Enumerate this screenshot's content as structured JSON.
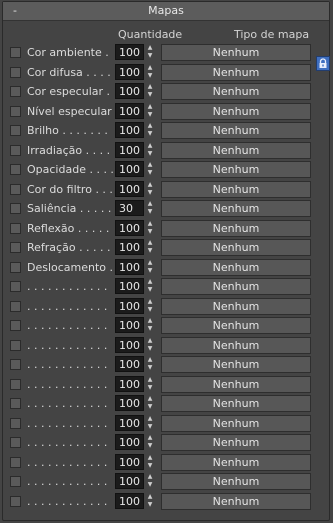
{
  "rollout": {
    "title": "Mapas",
    "collapse_symbol": "-"
  },
  "headers": {
    "amount": "Quantidade",
    "map_type": "Tipo de mapa"
  },
  "lock_icon": "lock-icon",
  "rows": [
    {
      "label": "Cor ambiente . .",
      "amount": "100",
      "map": "Nenhum"
    },
    {
      "label": "Cor difusa . . . .",
      "amount": "100",
      "map": "Nenhum"
    },
    {
      "label": "Cor especular . .",
      "amount": "100",
      "map": "Nenhum"
    },
    {
      "label": "Nível especular .",
      "amount": "100",
      "map": "Nenhum"
    },
    {
      "label": "Brilho . . . . . . .",
      "amount": "100",
      "map": "Nenhum"
    },
    {
      "label": "Irradiação . . . .",
      "amount": "100",
      "map": "Nenhum"
    },
    {
      "label": "Opacidade . . . .",
      "amount": "100",
      "map": "Nenhum"
    },
    {
      "label": "Cor do filtro . . .",
      "amount": "100",
      "map": "Nenhum"
    },
    {
      "label": "Saliência . . . . . .",
      "amount": "30",
      "map": "Nenhum"
    },
    {
      "label": "Reflexão . . . . .",
      "amount": "100",
      "map": "Nenhum"
    },
    {
      "label": "Refração . . . . .",
      "amount": "100",
      "map": "Nenhum"
    },
    {
      "label": "Deslocamento . .",
      "amount": "100",
      "map": "Nenhum"
    },
    {
      "label": ". . . . . . . . . . . .",
      "amount": "100",
      "map": "Nenhum"
    },
    {
      "label": ". . . . . . . . . . . .",
      "amount": "100",
      "map": "Nenhum"
    },
    {
      "label": ". . . . . . . . . . . .",
      "amount": "100",
      "map": "Nenhum"
    },
    {
      "label": ". . . . . . . . . . . .",
      "amount": "100",
      "map": "Nenhum"
    },
    {
      "label": ". . . . . . . . . . . .",
      "amount": "100",
      "map": "Nenhum"
    },
    {
      "label": ". . . . . . . . . . . .",
      "amount": "100",
      "map": "Nenhum"
    },
    {
      "label": ". . . . . . . . . . . .",
      "amount": "100",
      "map": "Nenhum"
    },
    {
      "label": ". . . . . . . . . . . .",
      "amount": "100",
      "map": "Nenhum"
    },
    {
      "label": ". . . . . . . . . . . .",
      "amount": "100",
      "map": "Nenhum"
    },
    {
      "label": ". . . . . . . . . . . .",
      "amount": "100",
      "map": "Nenhum"
    },
    {
      "label": ". . . . . . . . . . . .",
      "amount": "100",
      "map": "Nenhum"
    },
    {
      "label": ". . . . . . . . . . . .",
      "amount": "100",
      "map": "Nenhum"
    }
  ]
}
